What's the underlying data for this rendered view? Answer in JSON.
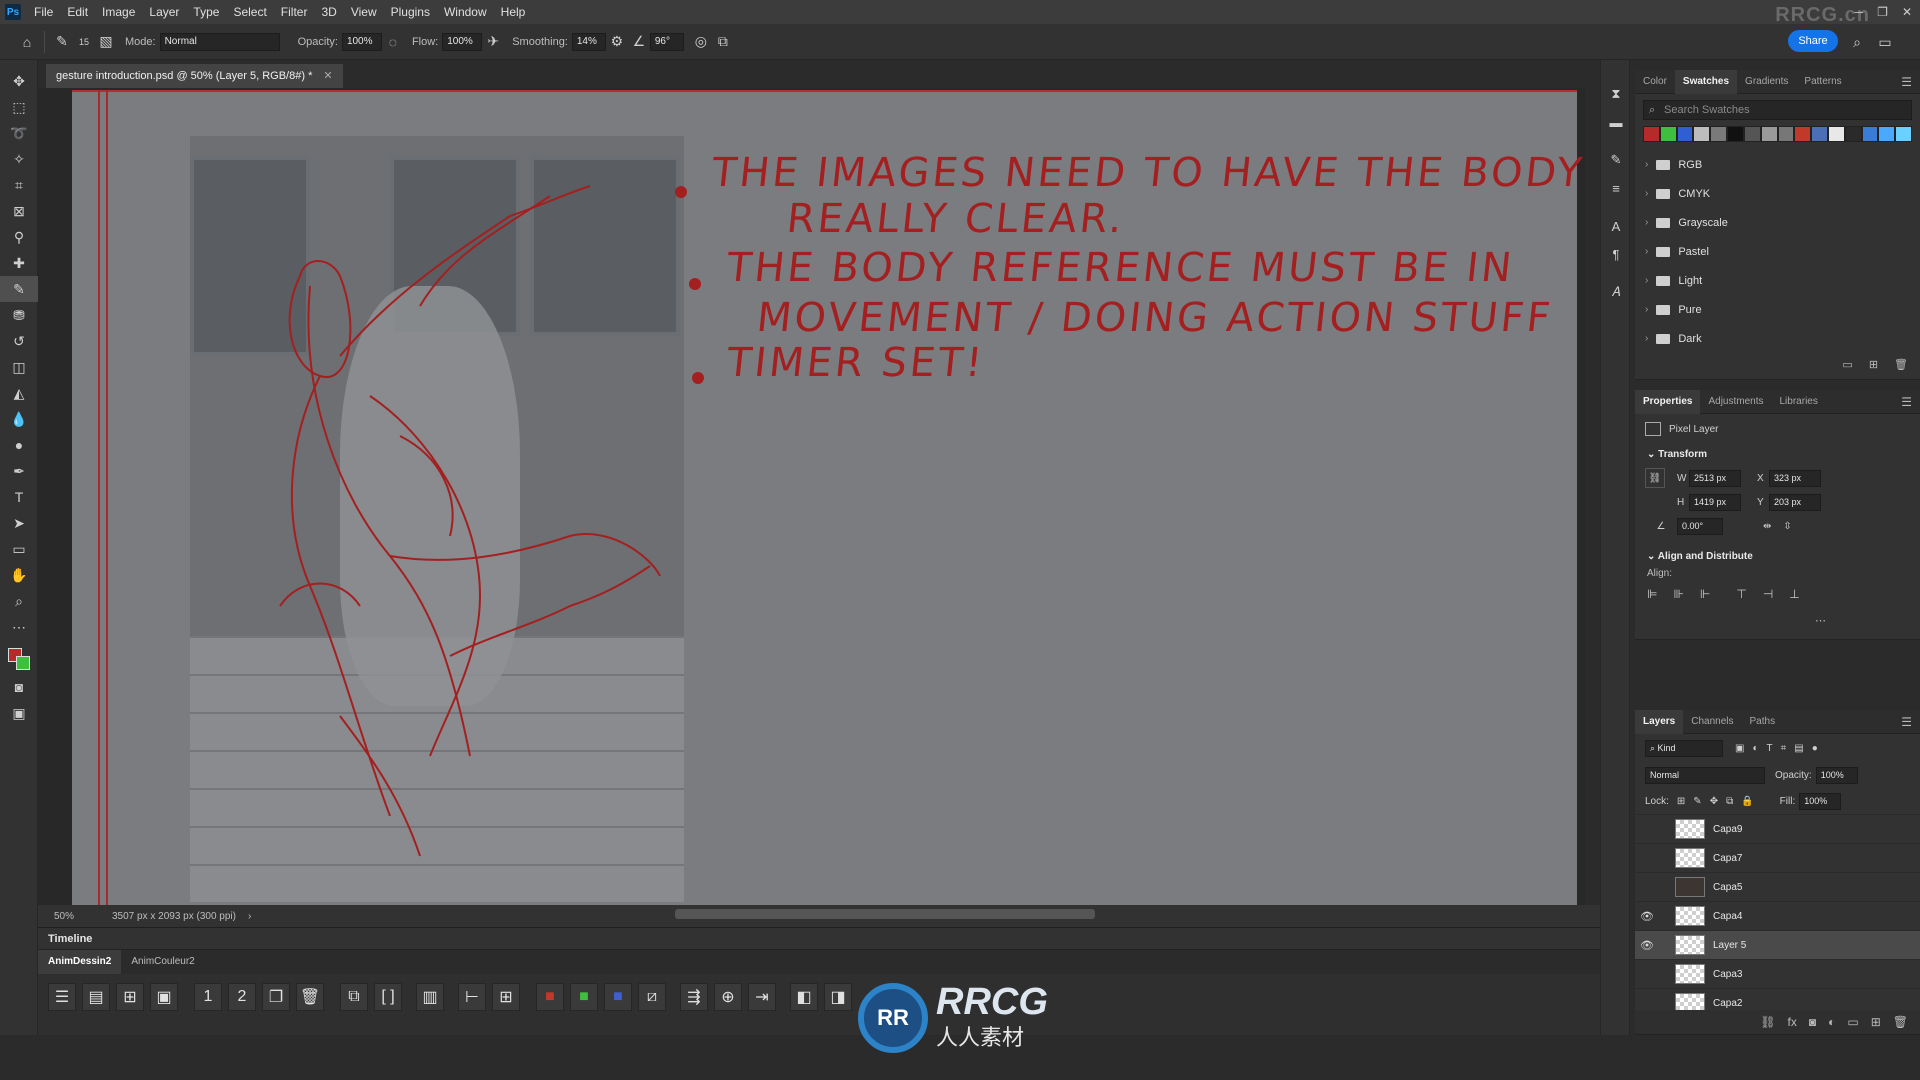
{
  "menubar": {
    "app": "Ps",
    "items": [
      "File",
      "Edit",
      "Image",
      "Layer",
      "Type",
      "Select",
      "Filter",
      "3D",
      "View",
      "Plugins",
      "Window",
      "Help"
    ],
    "watermark": "RRCG.cn"
  },
  "options": {
    "brush_size": "15",
    "mode_label": "Mode:",
    "mode_value": "Normal",
    "opacity_label": "Opacity:",
    "opacity_value": "100%",
    "flow_label": "Flow:",
    "flow_value": "100%",
    "smoothing_label": "Smoothing:",
    "smoothing_value": "14%",
    "angle_value": "96°",
    "share_label": "Share"
  },
  "document": {
    "tab_title": "gesture introduction.psd @ 50% (Layer 5, RGB/8#) *",
    "zoom": "50%",
    "doc_info": "3507 px x 2093 px (300 ppi)"
  },
  "canvas_notes": [
    {
      "line1": "THE IMAGES NEED TO HAVE THE BODY",
      "line2": "REALLY CLEAR."
    },
    {
      "line1": "THE BODY REFERENCE MUST BE IN",
      "line2": "MOVEMENT / DOING ACTION STUFF"
    },
    {
      "line1": "TIMER SET!",
      "line2": ""
    }
  ],
  "timeline": {
    "title": "Timeline",
    "tabs": [
      "AnimDessin2",
      "AnimCouleur2"
    ]
  },
  "watermark_bottom": {
    "logo": "RR",
    "text": "RRCG",
    "subtext": "人人素材"
  },
  "swatches_panel": {
    "tabs": [
      "Color",
      "Swatches",
      "Gradients",
      "Patterns"
    ],
    "active_tab": "Swatches",
    "search_placeholder": "Search Swatches",
    "colors": [
      "#b52a2a",
      "#3fbf3f",
      "#2f5fd0",
      "#bdbdbd",
      "#7a7a7a",
      "#111111",
      "#555555",
      "#9a9a9a",
      "#777777",
      "#c0392b",
      "#4a6fb5",
      "#e8e8e8",
      "#2a2a2a",
      "#3a7bd5",
      "#4aa8ff",
      "#6ad0ff"
    ],
    "groups": [
      "RGB",
      "CMYK",
      "Grayscale",
      "Pastel",
      "Light",
      "Pure",
      "Dark"
    ]
  },
  "properties_panel": {
    "tabs": [
      "Properties",
      "Adjustments",
      "Libraries"
    ],
    "layer_type": "Pixel Layer",
    "transform_label": "Transform",
    "w_label": "W",
    "w_value": "2513 px",
    "h_label": "H",
    "h_value": "1419 px",
    "x_label": "X",
    "x_value": "323 px",
    "y_label": "Y",
    "y_value": "203 px",
    "angle_value": "0.00°",
    "align_label": "Align and Distribute",
    "align_sub": "Align:"
  },
  "layers_panel": {
    "tabs": [
      "Layers",
      "Channels",
      "Paths"
    ],
    "kind_label": "Kind",
    "blend_mode": "Normal",
    "opacity_label": "Opacity:",
    "opacity_value": "100%",
    "lock_label": "Lock:",
    "fill_label": "Fill:",
    "fill_value": "100%",
    "layers": [
      {
        "name": "Capa9",
        "visible": false,
        "thumb": "checker",
        "selected": false
      },
      {
        "name": "Capa7",
        "visible": false,
        "thumb": "checker",
        "selected": false
      },
      {
        "name": "Capa5",
        "visible": false,
        "thumb": "dark",
        "selected": false
      },
      {
        "name": "Capa4",
        "visible": true,
        "thumb": "checker",
        "selected": false
      },
      {
        "name": "Layer 5",
        "visible": true,
        "thumb": "checker",
        "selected": true
      },
      {
        "name": "Capa3",
        "visible": false,
        "thumb": "checker",
        "selected": false
      },
      {
        "name": "Capa2",
        "visible": false,
        "thumb": "checker",
        "selected": false
      }
    ]
  },
  "colors": {
    "accent": "#1473e6",
    "ink_red": "#a41f1f",
    "foreground": "#b52a2a",
    "background": "#3fbf3f"
  }
}
